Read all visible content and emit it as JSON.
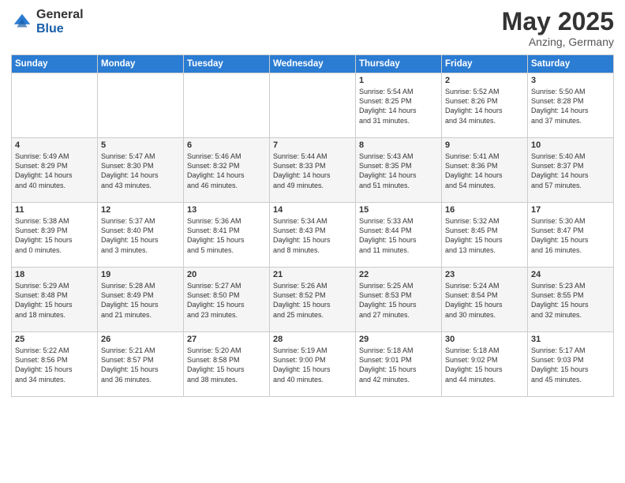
{
  "header": {
    "logo_general": "General",
    "logo_blue": "Blue",
    "month": "May 2025",
    "location": "Anzing, Germany"
  },
  "days_of_week": [
    "Sunday",
    "Monday",
    "Tuesday",
    "Wednesday",
    "Thursday",
    "Friday",
    "Saturday"
  ],
  "weeks": [
    [
      {
        "day": "",
        "info": ""
      },
      {
        "day": "",
        "info": ""
      },
      {
        "day": "",
        "info": ""
      },
      {
        "day": "",
        "info": ""
      },
      {
        "day": "1",
        "info": "Sunrise: 5:54 AM\nSunset: 8:25 PM\nDaylight: 14 hours\nand 31 minutes."
      },
      {
        "day": "2",
        "info": "Sunrise: 5:52 AM\nSunset: 8:26 PM\nDaylight: 14 hours\nand 34 minutes."
      },
      {
        "day": "3",
        "info": "Sunrise: 5:50 AM\nSunset: 8:28 PM\nDaylight: 14 hours\nand 37 minutes."
      }
    ],
    [
      {
        "day": "4",
        "info": "Sunrise: 5:49 AM\nSunset: 8:29 PM\nDaylight: 14 hours\nand 40 minutes."
      },
      {
        "day": "5",
        "info": "Sunrise: 5:47 AM\nSunset: 8:30 PM\nDaylight: 14 hours\nand 43 minutes."
      },
      {
        "day": "6",
        "info": "Sunrise: 5:46 AM\nSunset: 8:32 PM\nDaylight: 14 hours\nand 46 minutes."
      },
      {
        "day": "7",
        "info": "Sunrise: 5:44 AM\nSunset: 8:33 PM\nDaylight: 14 hours\nand 49 minutes."
      },
      {
        "day": "8",
        "info": "Sunrise: 5:43 AM\nSunset: 8:35 PM\nDaylight: 14 hours\nand 51 minutes."
      },
      {
        "day": "9",
        "info": "Sunrise: 5:41 AM\nSunset: 8:36 PM\nDaylight: 14 hours\nand 54 minutes."
      },
      {
        "day": "10",
        "info": "Sunrise: 5:40 AM\nSunset: 8:37 PM\nDaylight: 14 hours\nand 57 minutes."
      }
    ],
    [
      {
        "day": "11",
        "info": "Sunrise: 5:38 AM\nSunset: 8:39 PM\nDaylight: 15 hours\nand 0 minutes."
      },
      {
        "day": "12",
        "info": "Sunrise: 5:37 AM\nSunset: 8:40 PM\nDaylight: 15 hours\nand 3 minutes."
      },
      {
        "day": "13",
        "info": "Sunrise: 5:36 AM\nSunset: 8:41 PM\nDaylight: 15 hours\nand 5 minutes."
      },
      {
        "day": "14",
        "info": "Sunrise: 5:34 AM\nSunset: 8:43 PM\nDaylight: 15 hours\nand 8 minutes."
      },
      {
        "day": "15",
        "info": "Sunrise: 5:33 AM\nSunset: 8:44 PM\nDaylight: 15 hours\nand 11 minutes."
      },
      {
        "day": "16",
        "info": "Sunrise: 5:32 AM\nSunset: 8:45 PM\nDaylight: 15 hours\nand 13 minutes."
      },
      {
        "day": "17",
        "info": "Sunrise: 5:30 AM\nSunset: 8:47 PM\nDaylight: 15 hours\nand 16 minutes."
      }
    ],
    [
      {
        "day": "18",
        "info": "Sunrise: 5:29 AM\nSunset: 8:48 PM\nDaylight: 15 hours\nand 18 minutes."
      },
      {
        "day": "19",
        "info": "Sunrise: 5:28 AM\nSunset: 8:49 PM\nDaylight: 15 hours\nand 21 minutes."
      },
      {
        "day": "20",
        "info": "Sunrise: 5:27 AM\nSunset: 8:50 PM\nDaylight: 15 hours\nand 23 minutes."
      },
      {
        "day": "21",
        "info": "Sunrise: 5:26 AM\nSunset: 8:52 PM\nDaylight: 15 hours\nand 25 minutes."
      },
      {
        "day": "22",
        "info": "Sunrise: 5:25 AM\nSunset: 8:53 PM\nDaylight: 15 hours\nand 27 minutes."
      },
      {
        "day": "23",
        "info": "Sunrise: 5:24 AM\nSunset: 8:54 PM\nDaylight: 15 hours\nand 30 minutes."
      },
      {
        "day": "24",
        "info": "Sunrise: 5:23 AM\nSunset: 8:55 PM\nDaylight: 15 hours\nand 32 minutes."
      }
    ],
    [
      {
        "day": "25",
        "info": "Sunrise: 5:22 AM\nSunset: 8:56 PM\nDaylight: 15 hours\nand 34 minutes."
      },
      {
        "day": "26",
        "info": "Sunrise: 5:21 AM\nSunset: 8:57 PM\nDaylight: 15 hours\nand 36 minutes."
      },
      {
        "day": "27",
        "info": "Sunrise: 5:20 AM\nSunset: 8:58 PM\nDaylight: 15 hours\nand 38 minutes."
      },
      {
        "day": "28",
        "info": "Sunrise: 5:19 AM\nSunset: 9:00 PM\nDaylight: 15 hours\nand 40 minutes."
      },
      {
        "day": "29",
        "info": "Sunrise: 5:18 AM\nSunset: 9:01 PM\nDaylight: 15 hours\nand 42 minutes."
      },
      {
        "day": "30",
        "info": "Sunrise: 5:18 AM\nSunset: 9:02 PM\nDaylight: 15 hours\nand 44 minutes."
      },
      {
        "day": "31",
        "info": "Sunrise: 5:17 AM\nSunset: 9:03 PM\nDaylight: 15 hours\nand 45 minutes."
      }
    ]
  ]
}
